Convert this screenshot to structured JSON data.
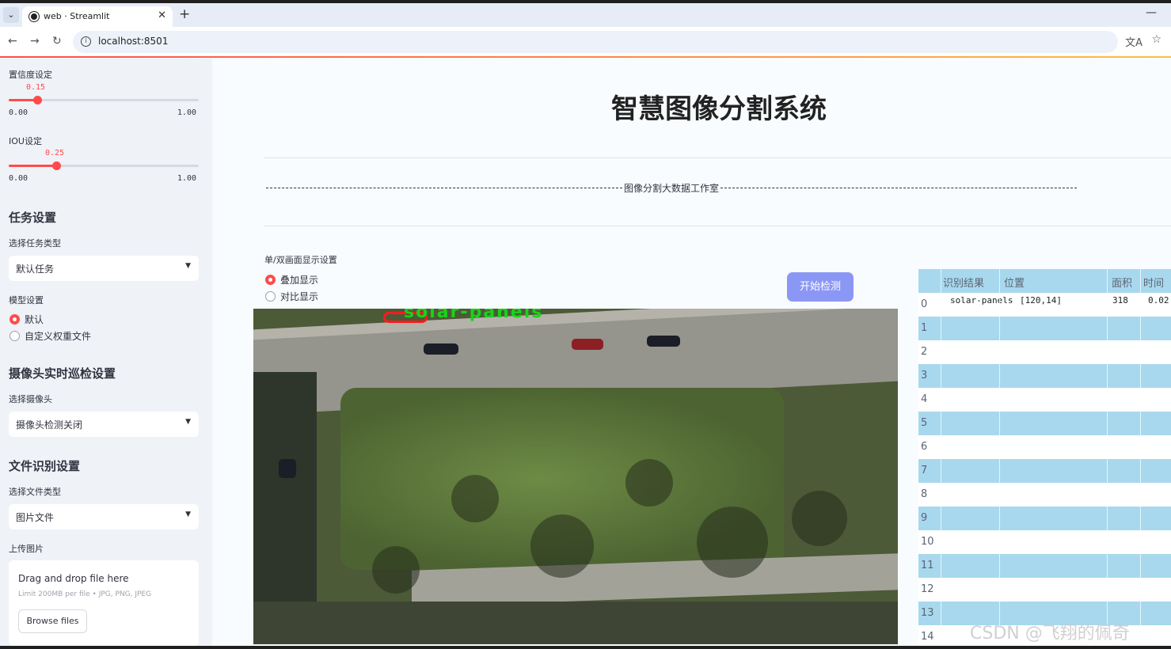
{
  "browser": {
    "tab_title": "web · Streamlit",
    "url": "localhost:8501"
  },
  "sidebar": {
    "confidence": {
      "label": "置信度设定",
      "value_text": "0.15",
      "value": 0.15,
      "min_text": "0.00",
      "max_text": "1.00"
    },
    "iou": {
      "label": "IOU设定",
      "value_text": "0.25",
      "value": 0.25,
      "min_text": "0.00",
      "max_text": "1.00"
    },
    "task_heading": "任务设置",
    "task_type_label": "选择任务类型",
    "task_type_value": "默认任务",
    "model_label": "模型设置",
    "model_options": [
      "默认",
      "自定义权重文件"
    ],
    "model_selected": 0,
    "camera_heading": "摄像头实时巡检设置",
    "camera_label": "选择摄像头",
    "camera_value": "摄像头检测关闭",
    "file_heading": "文件识别设置",
    "file_type_label": "选择文件类型",
    "file_type_value": "图片文件",
    "upload_label": "上传图片",
    "upload_title": "Drag and drop file here",
    "upload_limit": "Limit 200MB per file • JPG, PNG, JPEG",
    "browse_label": "Browse files"
  },
  "main": {
    "title": "智慧图像分割系统",
    "subtitle": "图像分割大数据工作室",
    "display_label": "单/双画面显示设置",
    "display_options": [
      "叠加显示",
      "对比显示"
    ],
    "display_selected": 0,
    "detect_button": "开始检测",
    "detection_label": "solar-panels"
  },
  "table": {
    "headers": [
      "识别结果",
      "位置",
      "面积",
      "时间"
    ],
    "rows": [
      {
        "index": "0",
        "result": "solar-panels",
        "position": "[120,14]",
        "area": "318",
        "time": "0.02"
      },
      {
        "index": "1"
      },
      {
        "index": "2"
      },
      {
        "index": "3"
      },
      {
        "index": "4"
      },
      {
        "index": "5"
      },
      {
        "index": "6"
      },
      {
        "index": "7"
      },
      {
        "index": "8"
      },
      {
        "index": "9"
      },
      {
        "index": "10"
      },
      {
        "index": "11"
      },
      {
        "index": "12"
      },
      {
        "index": "13"
      },
      {
        "index": "14"
      }
    ]
  },
  "watermark": "CSDN @飞翔的佩奇",
  "colors": {
    "accent": "#ff4b4b",
    "button": "#8b97f5",
    "table_stripe": "#a8d8ee",
    "sidebar_bg": "#eff2f7"
  }
}
